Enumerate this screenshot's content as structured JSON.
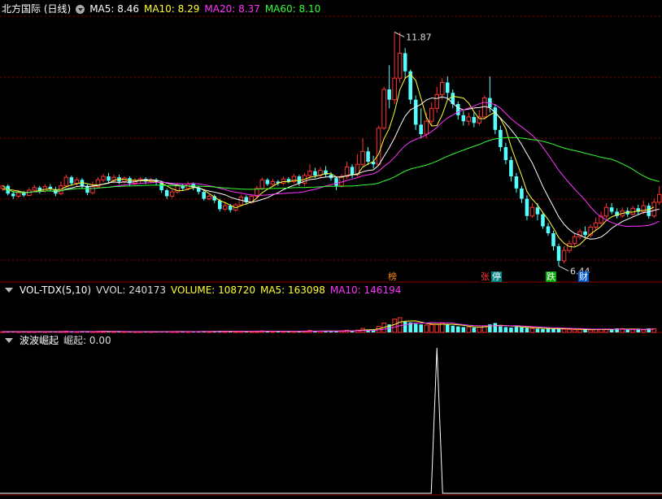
{
  "price_panel": {
    "title": "北方国际 (日线)",
    "indicators": [
      {
        "label": "MA5:",
        "value": "8.46",
        "color": "#ffffff"
      },
      {
        "label": "MA10:",
        "value": "8.29",
        "color": "#ffff33"
      },
      {
        "label": "MA20:",
        "value": "8.37",
        "color": "#ff33ff"
      },
      {
        "label": "MA60:",
        "value": "8.10",
        "color": "#33ff33"
      }
    ],
    "high_label": "11.87",
    "low_label": "6.44",
    "badges": [
      {
        "text": "榜",
        "color": "#ff8800",
        "bg": "#000000"
      },
      {
        "text": "张",
        "color": "#ff3333",
        "bg": "#000000"
      },
      {
        "text": "停",
        "color": "#ffffff",
        "bg": "#008080"
      },
      {
        "text": "跌",
        "color": "#ffffff",
        "bg": "#00aa00"
      },
      {
        "text": "财",
        "color": "#ffffff",
        "bg": "#0055cc"
      }
    ]
  },
  "volume_panel": {
    "title": "VOL-TDX(5,10)",
    "indicators": [
      {
        "label": "VVOL:",
        "value": "240173",
        "color": "#dddddd"
      },
      {
        "label": "VOLUME:",
        "value": "108720",
        "color": "#ffff33"
      },
      {
        "label": "MA5:",
        "value": "163098",
        "color": "#ffff33"
      },
      {
        "label": "MA10:",
        "value": "146194",
        "color": "#ff33ff"
      }
    ]
  },
  "osc_panel": {
    "title": "波波崛起",
    "indicators": [
      {
        "label": "崛起:",
        "value": "0.00",
        "color": "#dddddd"
      }
    ]
  },
  "colors": {
    "up": "#ff3333",
    "down": "#54ffff",
    "grid": "#8b0000",
    "ma5": "#ffffff",
    "ma10": "#ffff33",
    "ma20": "#ff33ff",
    "ma60": "#33ff33"
  },
  "chart_data": {
    "type": "candlestick",
    "ylim": [
      6.2,
      12.2
    ],
    "candles": [
      [
        8.24,
        8.3,
        8.18,
        8.32
      ],
      [
        8.3,
        8.12,
        8.08,
        8.34
      ],
      [
        8.12,
        8.06,
        8.0,
        8.18
      ],
      [
        8.06,
        8.14,
        8.02,
        8.2
      ],
      [
        8.14,
        8.08,
        8.04,
        8.18
      ],
      [
        8.08,
        8.2,
        8.06,
        8.26
      ],
      [
        8.2,
        8.26,
        8.16,
        8.32
      ],
      [
        8.26,
        8.18,
        8.12,
        8.3
      ],
      [
        8.18,
        8.28,
        8.14,
        8.34
      ],
      [
        8.28,
        8.22,
        8.18,
        8.34
      ],
      [
        8.22,
        8.12,
        8.06,
        8.28
      ],
      [
        8.12,
        8.3,
        8.08,
        8.4
      ],
      [
        8.3,
        8.5,
        8.26,
        8.56
      ],
      [
        8.5,
        8.36,
        8.3,
        8.54
      ],
      [
        8.36,
        8.44,
        8.3,
        8.5
      ],
      [
        8.44,
        8.3,
        8.24,
        8.48
      ],
      [
        8.3,
        8.14,
        8.08,
        8.34
      ],
      [
        8.14,
        8.28,
        8.1,
        8.4
      ],
      [
        8.28,
        8.44,
        8.24,
        8.5
      ],
      [
        8.44,
        8.52,
        8.38,
        8.58
      ],
      [
        8.52,
        8.42,
        8.38,
        8.6
      ],
      [
        8.42,
        8.5,
        8.36,
        8.56
      ],
      [
        8.5,
        8.4,
        8.34,
        8.56
      ],
      [
        8.4,
        8.48,
        8.36,
        8.52
      ],
      [
        8.48,
        8.36,
        8.3,
        8.52
      ],
      [
        8.36,
        8.42,
        8.32,
        8.48
      ],
      [
        8.42,
        8.46,
        8.36,
        8.5
      ],
      [
        8.46,
        8.4,
        8.34,
        8.5
      ],
      [
        8.4,
        8.44,
        8.36,
        8.48
      ],
      [
        8.44,
        8.38,
        8.32,
        8.48
      ],
      [
        8.38,
        8.2,
        8.14,
        8.42
      ],
      [
        8.2,
        8.06,
        8.0,
        8.24
      ],
      [
        8.06,
        8.16,
        8.02,
        8.2
      ],
      [
        8.16,
        8.3,
        8.12,
        8.36
      ],
      [
        8.3,
        8.24,
        8.18,
        8.34
      ],
      [
        8.24,
        8.34,
        8.2,
        8.4
      ],
      [
        8.34,
        8.26,
        8.2,
        8.38
      ],
      [
        8.26,
        8.16,
        8.1,
        8.3
      ],
      [
        8.16,
        8.0,
        7.96,
        8.2
      ],
      [
        8.0,
        8.06,
        7.96,
        8.1
      ],
      [
        8.06,
        7.96,
        7.9,
        8.1
      ],
      [
        7.96,
        7.76,
        7.7,
        8.0
      ],
      [
        7.76,
        7.84,
        7.72,
        7.9
      ],
      [
        7.84,
        7.74,
        7.68,
        7.88
      ],
      [
        7.74,
        7.86,
        7.7,
        7.9
      ],
      [
        7.86,
        8.04,
        7.82,
        8.1
      ],
      [
        8.04,
        7.92,
        7.86,
        8.08
      ],
      [
        7.92,
        8.06,
        7.88,
        8.1
      ],
      [
        8.06,
        8.24,
        8.02,
        8.3
      ],
      [
        8.24,
        8.44,
        8.2,
        8.5
      ],
      [
        8.44,
        8.34,
        8.3,
        8.48
      ],
      [
        8.34,
        8.4,
        8.3,
        8.46
      ],
      [
        8.4,
        8.36,
        8.3,
        8.44
      ],
      [
        8.36,
        8.46,
        8.32,
        8.52
      ],
      [
        8.46,
        8.4,
        8.36,
        8.5
      ],
      [
        8.4,
        8.52,
        8.36,
        8.58
      ],
      [
        8.52,
        8.36,
        8.3,
        8.56
      ],
      [
        8.36,
        8.54,
        8.3,
        8.6
      ],
      [
        8.54,
        8.64,
        8.46,
        8.8
      ],
      [
        8.64,
        8.54,
        8.48,
        8.72
      ],
      [
        8.54,
        8.66,
        8.48,
        8.74
      ],
      [
        8.66,
        8.56,
        8.5,
        8.76
      ],
      [
        8.56,
        8.48,
        8.42,
        8.62
      ],
      [
        8.48,
        8.3,
        8.2,
        8.52
      ],
      [
        8.3,
        8.52,
        8.26,
        8.58
      ],
      [
        8.52,
        8.74,
        8.46,
        8.86
      ],
      [
        8.74,
        8.56,
        8.48,
        8.8
      ],
      [
        8.56,
        8.8,
        8.52,
        9.04
      ],
      [
        8.8,
        9.1,
        8.76,
        9.4
      ],
      [
        9.1,
        8.86,
        8.78,
        9.2
      ],
      [
        8.86,
        8.8,
        8.7,
        9.0
      ],
      [
        8.8,
        9.64,
        8.76,
        9.7
      ],
      [
        9.64,
        10.54,
        9.6,
        10.6
      ],
      [
        10.54,
        10.3,
        10.1,
        11.1
      ],
      [
        10.3,
        10.8,
        10.2,
        11.87
      ],
      [
        10.8,
        11.38,
        10.7,
        11.87
      ],
      [
        11.38,
        10.96,
        10.8,
        11.5
      ],
      [
        10.96,
        10.3,
        10.2,
        11.0
      ],
      [
        10.3,
        9.72,
        9.6,
        10.4
      ],
      [
        9.72,
        9.5,
        9.4,
        10.1
      ],
      [
        9.5,
        9.8,
        9.4,
        10.0
      ],
      [
        9.8,
        10.1,
        9.7,
        10.24
      ],
      [
        10.1,
        10.42,
        10.0,
        10.6
      ],
      [
        10.42,
        10.7,
        10.3,
        10.8
      ],
      [
        10.7,
        10.46,
        10.3,
        10.84
      ],
      [
        10.46,
        10.2,
        10.1,
        10.54
      ],
      [
        10.2,
        9.94,
        9.84,
        10.26
      ],
      [
        9.94,
        9.8,
        9.7,
        10.04
      ],
      [
        9.8,
        9.9,
        9.7,
        10.0
      ],
      [
        9.9,
        9.76,
        9.66,
        10.0
      ],
      [
        9.76,
        9.9,
        9.7,
        10.06
      ],
      [
        9.9,
        10.34,
        9.86,
        10.4
      ],
      [
        10.34,
        10.12,
        10.0,
        10.84
      ],
      [
        10.12,
        9.6,
        9.5,
        10.2
      ],
      [
        9.6,
        9.2,
        9.1,
        9.7
      ],
      [
        9.2,
        8.9,
        8.8,
        9.3
      ],
      [
        8.9,
        8.52,
        8.4,
        8.98
      ],
      [
        8.52,
        8.24,
        8.14,
        8.6
      ],
      [
        8.24,
        8.0,
        7.9,
        8.3
      ],
      [
        8.0,
        7.6,
        7.5,
        8.08
      ],
      [
        7.6,
        7.8,
        7.56,
        7.9
      ],
      [
        7.8,
        7.64,
        7.5,
        7.9
      ],
      [
        7.64,
        7.36,
        7.3,
        7.7
      ],
      [
        7.36,
        7.2,
        7.14,
        7.44
      ],
      [
        7.2,
        6.9,
        6.8,
        7.26
      ],
      [
        6.9,
        6.56,
        6.44,
        6.96
      ],
      [
        6.56,
        6.8,
        6.5,
        6.9
      ],
      [
        6.8,
        6.96,
        6.74,
        7.04
      ],
      [
        6.96,
        7.12,
        6.9,
        7.2
      ],
      [
        7.12,
        7.24,
        7.06,
        7.3
      ],
      [
        7.24,
        7.16,
        7.1,
        7.36
      ],
      [
        7.16,
        7.34,
        7.1,
        7.4
      ],
      [
        7.34,
        7.44,
        7.26,
        7.56
      ],
      [
        7.44,
        7.6,
        7.38,
        7.7
      ],
      [
        7.6,
        7.8,
        7.54,
        7.9
      ],
      [
        7.8,
        7.7,
        7.64,
        7.9
      ],
      [
        7.7,
        7.6,
        7.54,
        7.78
      ],
      [
        7.6,
        7.72,
        7.56,
        7.8
      ],
      [
        7.72,
        7.64,
        7.58,
        7.8
      ],
      [
        7.64,
        7.78,
        7.6,
        7.84
      ],
      [
        7.78,
        7.7,
        7.64,
        7.86
      ],
      [
        7.7,
        7.84,
        7.64,
        7.96
      ],
      [
        7.84,
        7.6,
        7.54,
        7.9
      ],
      [
        7.6,
        7.92,
        7.56,
        8.0
      ],
      [
        7.92,
        8.1,
        7.86,
        8.3
      ]
    ],
    "ma5": [
      8.22,
      8.22,
      8.2,
      8.18,
      8.15,
      8.15,
      8.17,
      8.19,
      8.22,
      8.23,
      8.21,
      8.22,
      8.28,
      8.32,
      8.35,
      8.38,
      8.35,
      8.32,
      8.32,
      8.34,
      8.36,
      8.43,
      8.46,
      8.45,
      8.43,
      8.43,
      8.42,
      8.42,
      8.41,
      8.4,
      8.36,
      8.3,
      8.23,
      8.19,
      8.19,
      8.22,
      8.26,
      8.26,
      8.2,
      8.12,
      8.04,
      7.96,
      7.91,
      7.85,
      7.79,
      7.84,
      7.88,
      7.92,
      8.02,
      8.14,
      8.22,
      8.29,
      8.36,
      8.4,
      8.39,
      8.43,
      8.42,
      8.45,
      8.5,
      8.52,
      8.55,
      8.59,
      8.58,
      8.51,
      8.5,
      8.54,
      8.56,
      8.56,
      8.74,
      8.81,
      8.86,
      9.04,
      9.39,
      9.63,
      10.02,
      10.53,
      10.8,
      10.89,
      10.75,
      10.33,
      9.9,
      9.69,
      9.7,
      9.95,
      10.3,
      10.38,
      10.36,
      10.34,
      10.22,
      10.02,
      9.86,
      9.86,
      9.95,
      10.01,
      9.86,
      9.63,
      9.21,
      8.87,
      8.54,
      8.17,
      7.99,
      7.86,
      7.68,
      7.52,
      7.32,
      7.1,
      6.97,
      6.89,
      6.88,
      6.94,
      7.06,
      7.18,
      7.27,
      7.36,
      7.5,
      7.58,
      7.63,
      7.66,
      7.69,
      7.69,
      7.72,
      7.73,
      7.75,
      7.81
    ]
  },
  "volume_chart": {
    "type": "bar",
    "ylim": [
      0,
      250000
    ],
    "values": [
      5000,
      6000,
      4000,
      5500,
      4500,
      6500,
      5000,
      4000,
      6000,
      5500,
      4800,
      7000,
      9000,
      6000,
      5000,
      6000,
      8000,
      6500,
      7500,
      9000,
      6000,
      5500,
      5000,
      6000,
      5000,
      4500,
      5000,
      5500,
      4500,
      5000,
      6500,
      8000,
      6000,
      7000,
      6500,
      5500,
      6000,
      7000,
      9000,
      6500,
      7000,
      10000,
      8000,
      7000,
      7500,
      9000,
      7000,
      6500,
      9000,
      12000,
      8000,
      7000,
      6500,
      8000,
      6500,
      9000,
      7000,
      9500,
      15000,
      10000,
      9000,
      11000,
      8000,
      12000,
      11000,
      16000,
      12000,
      17000,
      30000,
      22000,
      21000,
      45000,
      70000,
      60000,
      100000,
      110000,
      80000,
      75000,
      65000,
      60000,
      55000,
      58000,
      62000,
      70000,
      60000,
      50000,
      45000,
      40000,
      38000,
      36000,
      40000,
      50000,
      60000,
      70000,
      45000,
      40000,
      36000,
      42000,
      38000,
      34000,
      30000,
      28000,
      26000,
      30000,
      26000,
      32000,
      24000,
      22000,
      20000,
      22000,
      20000,
      18000,
      24000,
      22000,
      20000,
      24000,
      30000,
      28000,
      22000,
      20000,
      24000,
      18000,
      30000,
      28000
    ],
    "ma5": [
      5500,
      5500,
      5100,
      5200,
      5100,
      5300,
      5100,
      5100,
      5300,
      5400,
      5300,
      5500,
      6300,
      6300,
      6400,
      6600,
      6800,
      6300,
      6600,
      7400,
      7400,
      7300,
      6600,
      6300,
      5500,
      5300,
      5200,
      5200,
      4900,
      4900,
      5200,
      5900,
      6000,
      6700,
      7000,
      6600,
      6200,
      6200,
      6800,
      7000,
      7300,
      7900,
      8100,
      8100,
      7900,
      8300,
      7900,
      7400,
      7800,
      8700,
      8500,
      8900,
      8900,
      8500,
      7300,
      7400,
      7400,
      8000,
      9400,
      10000,
      10000,
      10900,
      10700,
      10000,
      10200,
      11600,
      11800,
      13600,
      17200,
      19400,
      20400,
      27000,
      37600,
      47600,
      59200,
      77000,
      84000,
      85000,
      86000,
      78000,
      68000,
      63600,
      60000,
      61000,
      61000,
      60000,
      57400,
      53400,
      46600,
      41800,
      39800,
      40800,
      45400,
      51200,
      53000,
      51000,
      48200,
      46600,
      40200,
      38000,
      36000,
      34400,
      31200,
      29600,
      28000,
      28400,
      27600,
      26800,
      24800,
      24000,
      21600,
      21200,
      20800,
      21200,
      21200,
      21600,
      24000,
      24800,
      24800,
      24800,
      24800,
      22400,
      22800,
      24000
    ],
    "ma10": [
      5500,
      5500,
      5300,
      5300,
      5200,
      5200,
      5200,
      5200,
      5200,
      5300,
      5300,
      5400,
      5800,
      5900,
      5900,
      6000,
      6000,
      6000,
      6400,
      6900,
      7100,
      7000,
      6500,
      6500,
      6400,
      6400,
      6300,
      6000,
      5600,
      5400,
      5400,
      5600,
      5600,
      5800,
      6000,
      6000,
      6100,
      6400,
      6700,
      6800,
      6800,
      6700,
      7000,
      7300,
      7500,
      7600,
      7600,
      7600,
      7900,
      8400,
      8300,
      8400,
      8200,
      8000,
      8000,
      8300,
      8000,
      8400,
      8700,
      9200,
      9200,
      9600,
      9700,
      9900,
      10200,
      10900,
      11400,
      12300,
      13900,
      14800,
      15400,
      19200,
      23800,
      31600,
      39800,
      50200,
      56000,
      64600,
      71600,
      70000,
      70500,
      75000,
      72000,
      72500,
      72500,
      70000,
      62600,
      58300,
      54000,
      51300,
      50400,
      49000,
      48400,
      49000,
      49600,
      50000,
      49700,
      50000,
      48000,
      45700,
      43800,
      41300,
      38900,
      36700,
      34000,
      33200,
      31900,
      30600,
      29300,
      28700,
      26800,
      24900,
      24300,
      24600,
      24800,
      24400,
      23900,
      24000,
      22800,
      22400,
      22800,
      23000,
      23600,
      24400
    ]
  },
  "osc_chart": {
    "type": "line",
    "ylim": [
      0,
      1
    ],
    "values_nonzero_index": 82,
    "peak": 1.0
  }
}
